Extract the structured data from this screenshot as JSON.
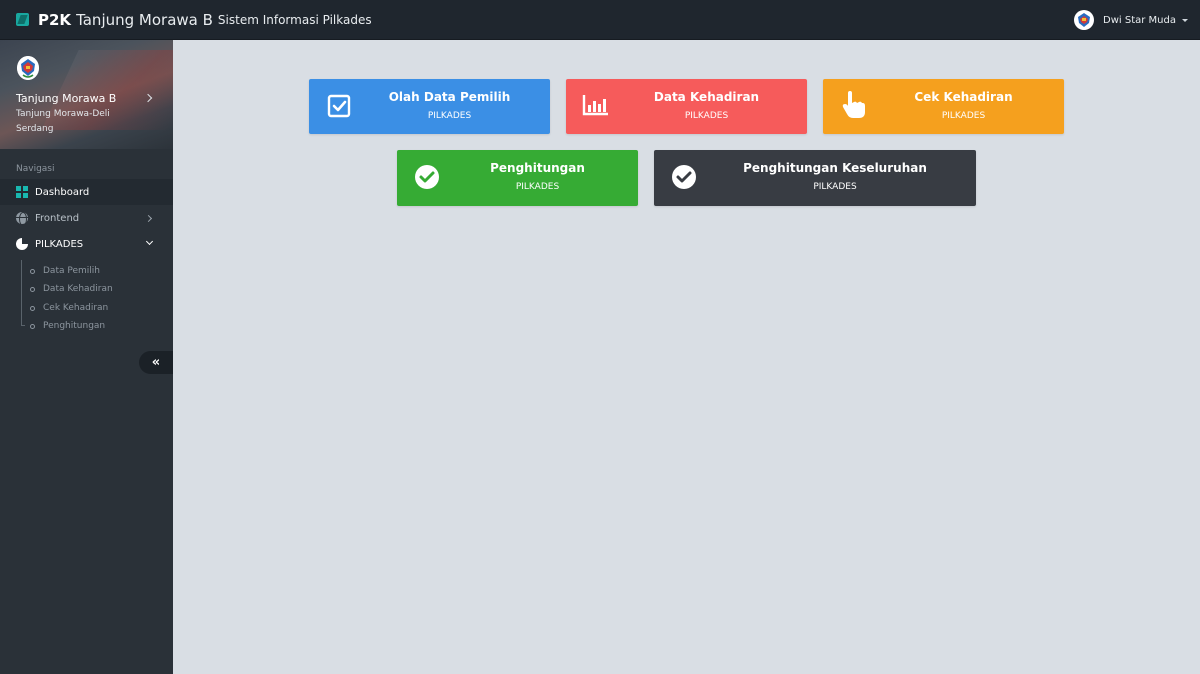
{
  "header": {
    "brand_bold": "P2K",
    "brand_name": "Tanjung Morawa B",
    "brand_sub": "Sistem Informasi Pilkades",
    "user_name": "Dwi Star Muda"
  },
  "sidebar": {
    "profile_title": "Tanjung Morawa B",
    "profile_sub": "Tanjung Morawa-Deli Serdang",
    "nav_label": "Navigasi",
    "items": [
      {
        "label": "Dashboard",
        "icon": "dashboard-grid-icon"
      },
      {
        "label": "Frontend",
        "icon": "globe-icon"
      },
      {
        "label": "PILKADES",
        "icon": "pie-chart-icon"
      }
    ],
    "subitems": [
      "Data Pemilih",
      "Data Kehadiran",
      "Cek Kehadiran",
      "Penghitungan"
    ],
    "collapse_label": "«"
  },
  "tiles": [
    {
      "title": "Olah Data Pemilih",
      "sub": "PILKADES",
      "color": "#3b8fe5",
      "icon": "checkbox-icon"
    },
    {
      "title": "Data Kehadiran",
      "sub": "PILKADES",
      "color": "#f65b5b",
      "icon": "bar-chart-icon"
    },
    {
      "title": "Cek Kehadiran",
      "sub": "PILKADES",
      "color": "#f5a01e",
      "icon": "pointer-hand-icon"
    },
    {
      "title": "Penghitungan",
      "sub": "PILKADES",
      "color": "#36ab34",
      "icon": "check-circle-icon"
    },
    {
      "title": "Penghitungan Keseluruhan",
      "sub": "PILKADES",
      "color": "#383c43",
      "icon": "check-circle-icon"
    }
  ]
}
